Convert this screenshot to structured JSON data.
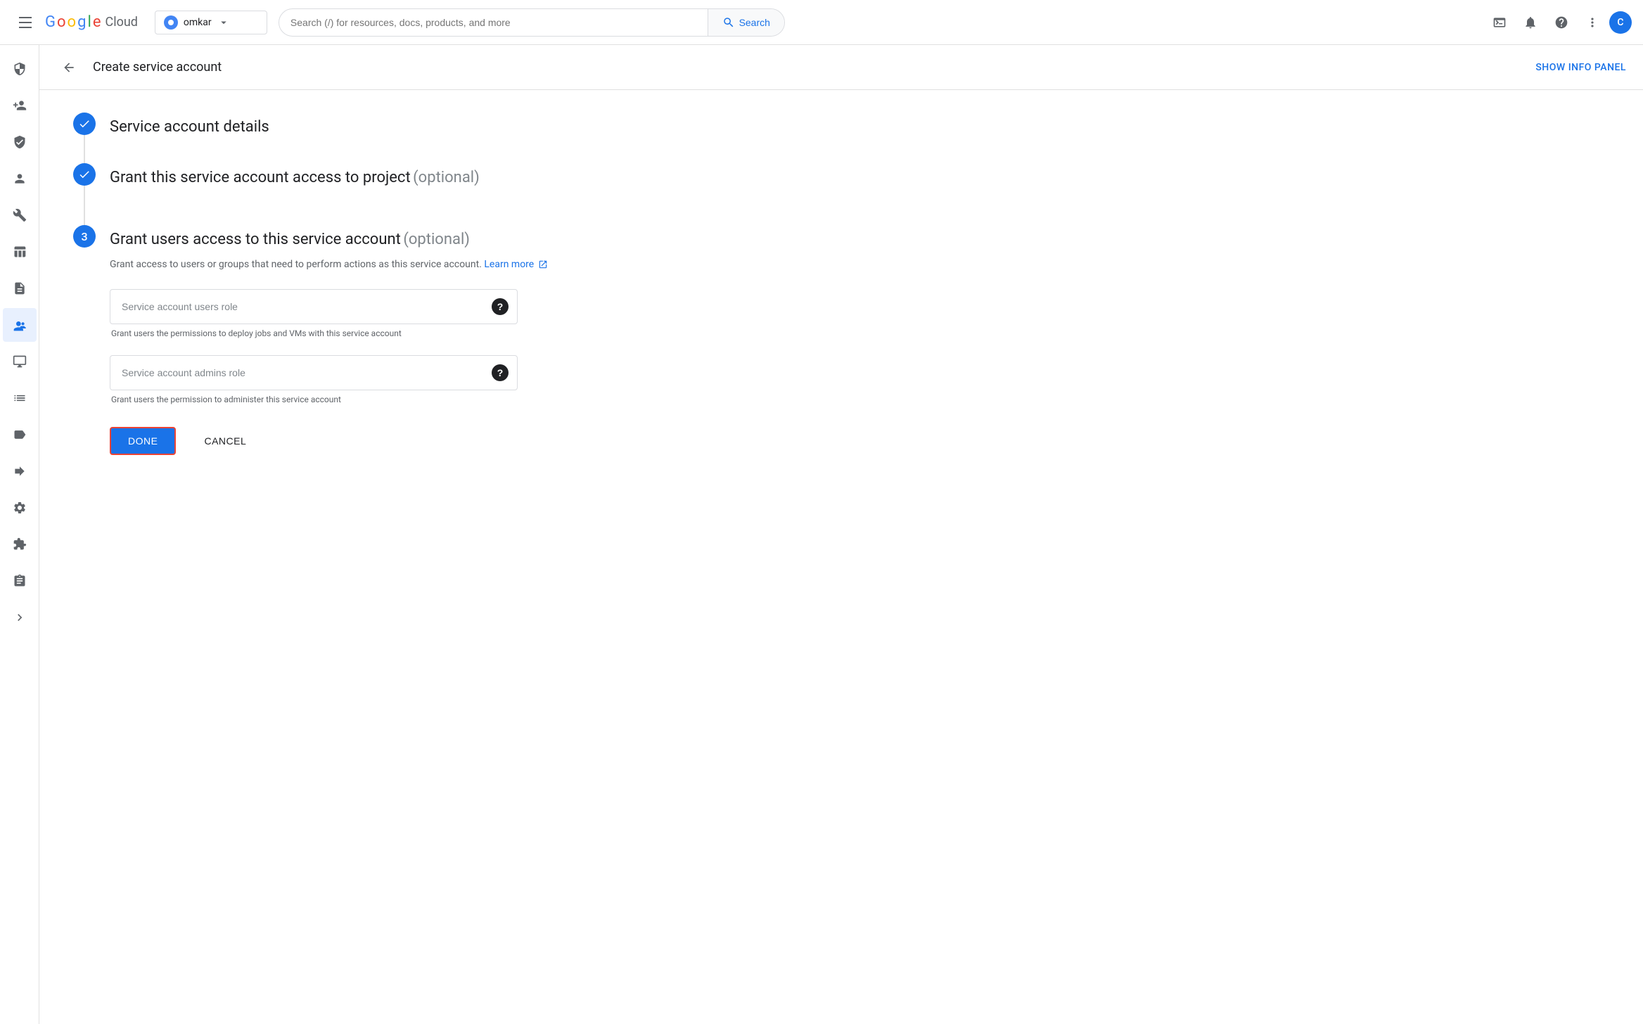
{
  "topNav": {
    "hamburger_label": "Main menu",
    "logo": {
      "letters": [
        "G",
        "o",
        "o",
        "g",
        "l",
        "e"
      ],
      "product": "Cloud"
    },
    "project": {
      "name": "omkar",
      "dropdown_label": "Select project"
    },
    "search": {
      "placeholder": "Search (/) for resources, docs, products, and more",
      "button_label": "Search"
    },
    "icons": {
      "terminal": "terminal-icon",
      "notifications": "notifications-icon",
      "help": "help-icon",
      "more": "more-vert-icon"
    },
    "avatar_label": "C"
  },
  "sidebar": {
    "items": [
      {
        "id": "shield",
        "label": "Security"
      },
      {
        "id": "person-add",
        "label": "Add member"
      },
      {
        "id": "shield2",
        "label": "Shield"
      },
      {
        "id": "person",
        "label": "Person"
      },
      {
        "id": "wrench",
        "label": "Wrench"
      },
      {
        "id": "table",
        "label": "Table"
      },
      {
        "id": "document",
        "label": "Document"
      },
      {
        "id": "service-accounts",
        "label": "Service Accounts",
        "active": true
      },
      {
        "id": "screen",
        "label": "Screen"
      },
      {
        "id": "list",
        "label": "List"
      },
      {
        "id": "tag",
        "label": "Tag"
      },
      {
        "id": "forward",
        "label": "Forward"
      },
      {
        "id": "settings",
        "label": "Settings"
      },
      {
        "id": "plugin",
        "label": "Plugin"
      },
      {
        "id": "audit",
        "label": "Audit"
      },
      {
        "id": "expand",
        "label": "Expand"
      }
    ]
  },
  "pageHeader": {
    "back_label": "Back",
    "title": "Create service account",
    "show_info_panel": "SHOW INFO PANEL"
  },
  "steps": [
    {
      "number": "✓",
      "state": "completed",
      "title": "Service account details",
      "optional_label": null,
      "description": null
    },
    {
      "number": "✓",
      "state": "completed",
      "title": "Grant this service account access to project",
      "optional_label": "(optional)",
      "description": null
    },
    {
      "number": "3",
      "state": "active",
      "title": "Grant users access to this service account",
      "optional_label": "(optional)",
      "description": "Grant access to users or groups that need to perform actions as this service account.",
      "learn_more_label": "Learn more",
      "fields": [
        {
          "id": "users-role",
          "placeholder": "Service account users role",
          "help_text": "Grant users the permissions to deploy jobs and VMs with this service account"
        },
        {
          "id": "admins-role",
          "placeholder": "Service account admins role",
          "help_text": "Grant users the permission to administer this service account"
        }
      ]
    }
  ],
  "buttons": {
    "done": "DONE",
    "cancel": "CANCEL"
  }
}
